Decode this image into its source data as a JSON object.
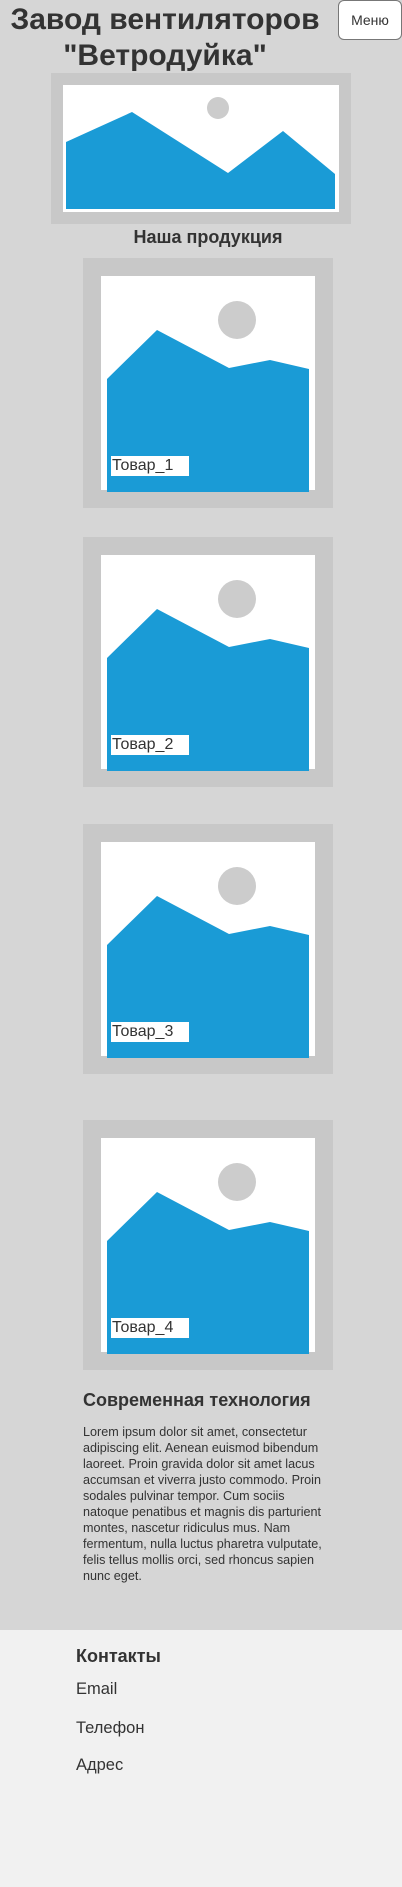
{
  "header": {
    "title_line1": "Завод вентиляторов",
    "title_line2": "\"Ветродуйка\"",
    "menu_label": "Меню"
  },
  "products_section": {
    "heading": "Наша продукция",
    "items": [
      {
        "label": "Товар_1"
      },
      {
        "label": "Товар_2"
      },
      {
        "label": "Товар_3"
      },
      {
        "label": "Товар_4"
      }
    ]
  },
  "technology": {
    "title": "Современная технология",
    "text": "Lorem ipsum dolor sit amet, consectetur adipiscing elit. Aenean euismod bibendum laoreet. Proin gravida dolor sit amet lacus accumsan et viverra justo commodo. Proin sodales pulvinar tempor. Cum sociis natoque penatibus et magnis dis parturient montes, nascetur ridiculus mus. Nam fermentum, nulla luctus pharetra vulputate, felis tellus mollis orci, sed rhoncus sapien nunc eget."
  },
  "footer": {
    "title": "Контакты",
    "items": [
      {
        "label": "Email"
      },
      {
        "label": "Телефон"
      },
      {
        "label": "Адрес"
      }
    ]
  },
  "icons": {
    "hero_image": "image-placeholder-icon",
    "product_image": "image-placeholder-icon"
  },
  "colors": {
    "page_background": "#d6d6d6",
    "frame": "#c8c8c8",
    "image_blue": "#1a9bd6",
    "sun_gray": "#cccccc",
    "footer_background": "#f1f1f1",
    "text": "#333333"
  }
}
